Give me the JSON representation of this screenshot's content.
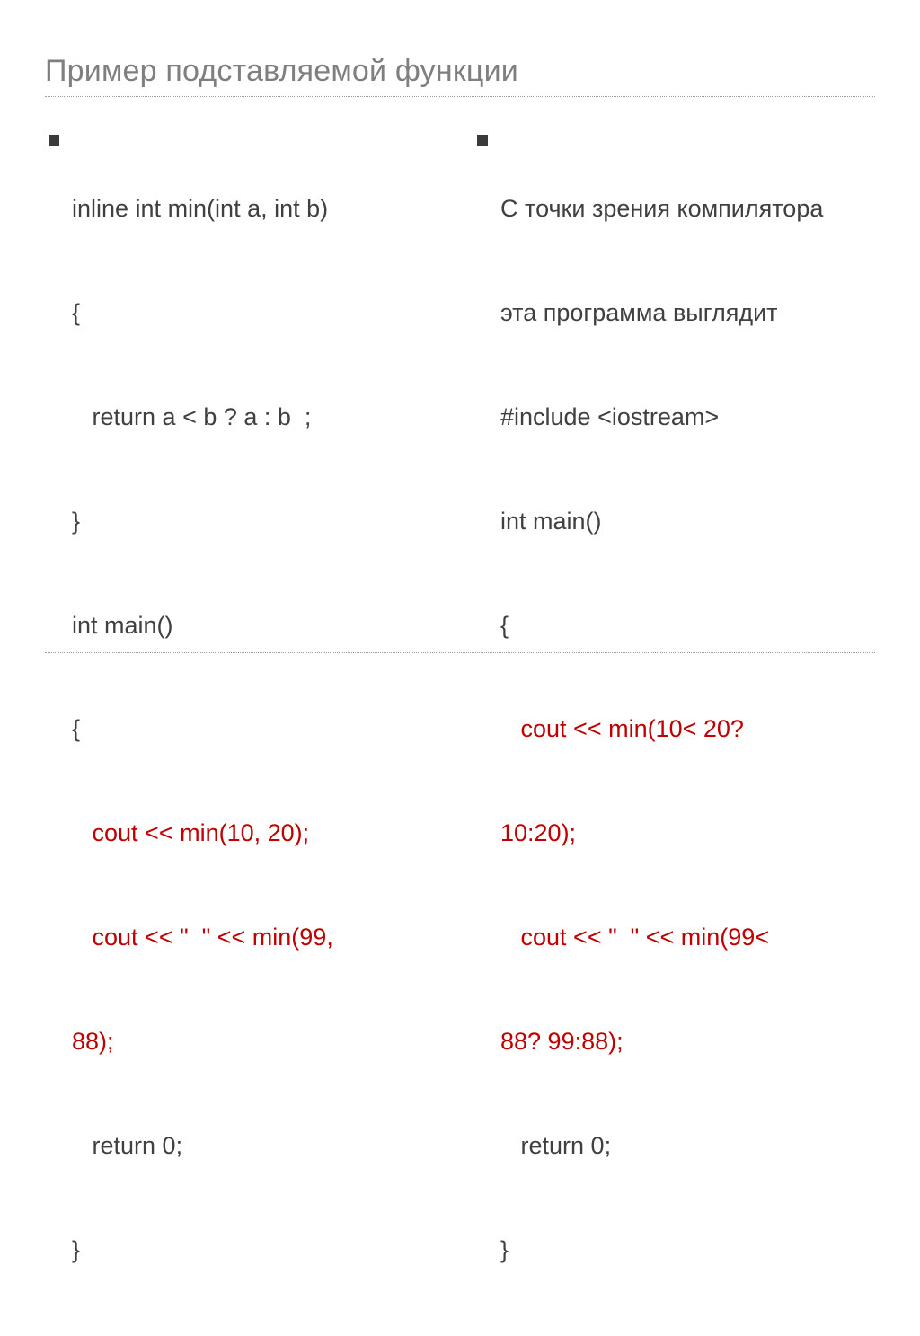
{
  "title": "Пример подставляемой функции",
  "left": {
    "l1": "inline int min(int a, int b)",
    "l2": "{",
    "l3": "   return a < b ? a : b  ;",
    "l4": "}",
    "l5": "int main()",
    "l6": "{",
    "l7": "   cout << min(10, 20);",
    "l8a": "   cout << \"  \" << min(99,",
    "l8b": "88);",
    "l9": "   return 0;",
    "l10": "}"
  },
  "right": {
    "intro1": "С точки зрения компилятора",
    "intro2": "эта программа выглядит",
    "l1": "#include <iostream>",
    "l2": "int main()",
    "l3": "{",
    "l4a": "   cout << min(10< 20?",
    "l4b": "10:20);",
    "l5a": "   cout << \"  \" << min(99<",
    "l5b": "88? 99:88);",
    "l6": "   return 0;",
    "l7": "}"
  }
}
